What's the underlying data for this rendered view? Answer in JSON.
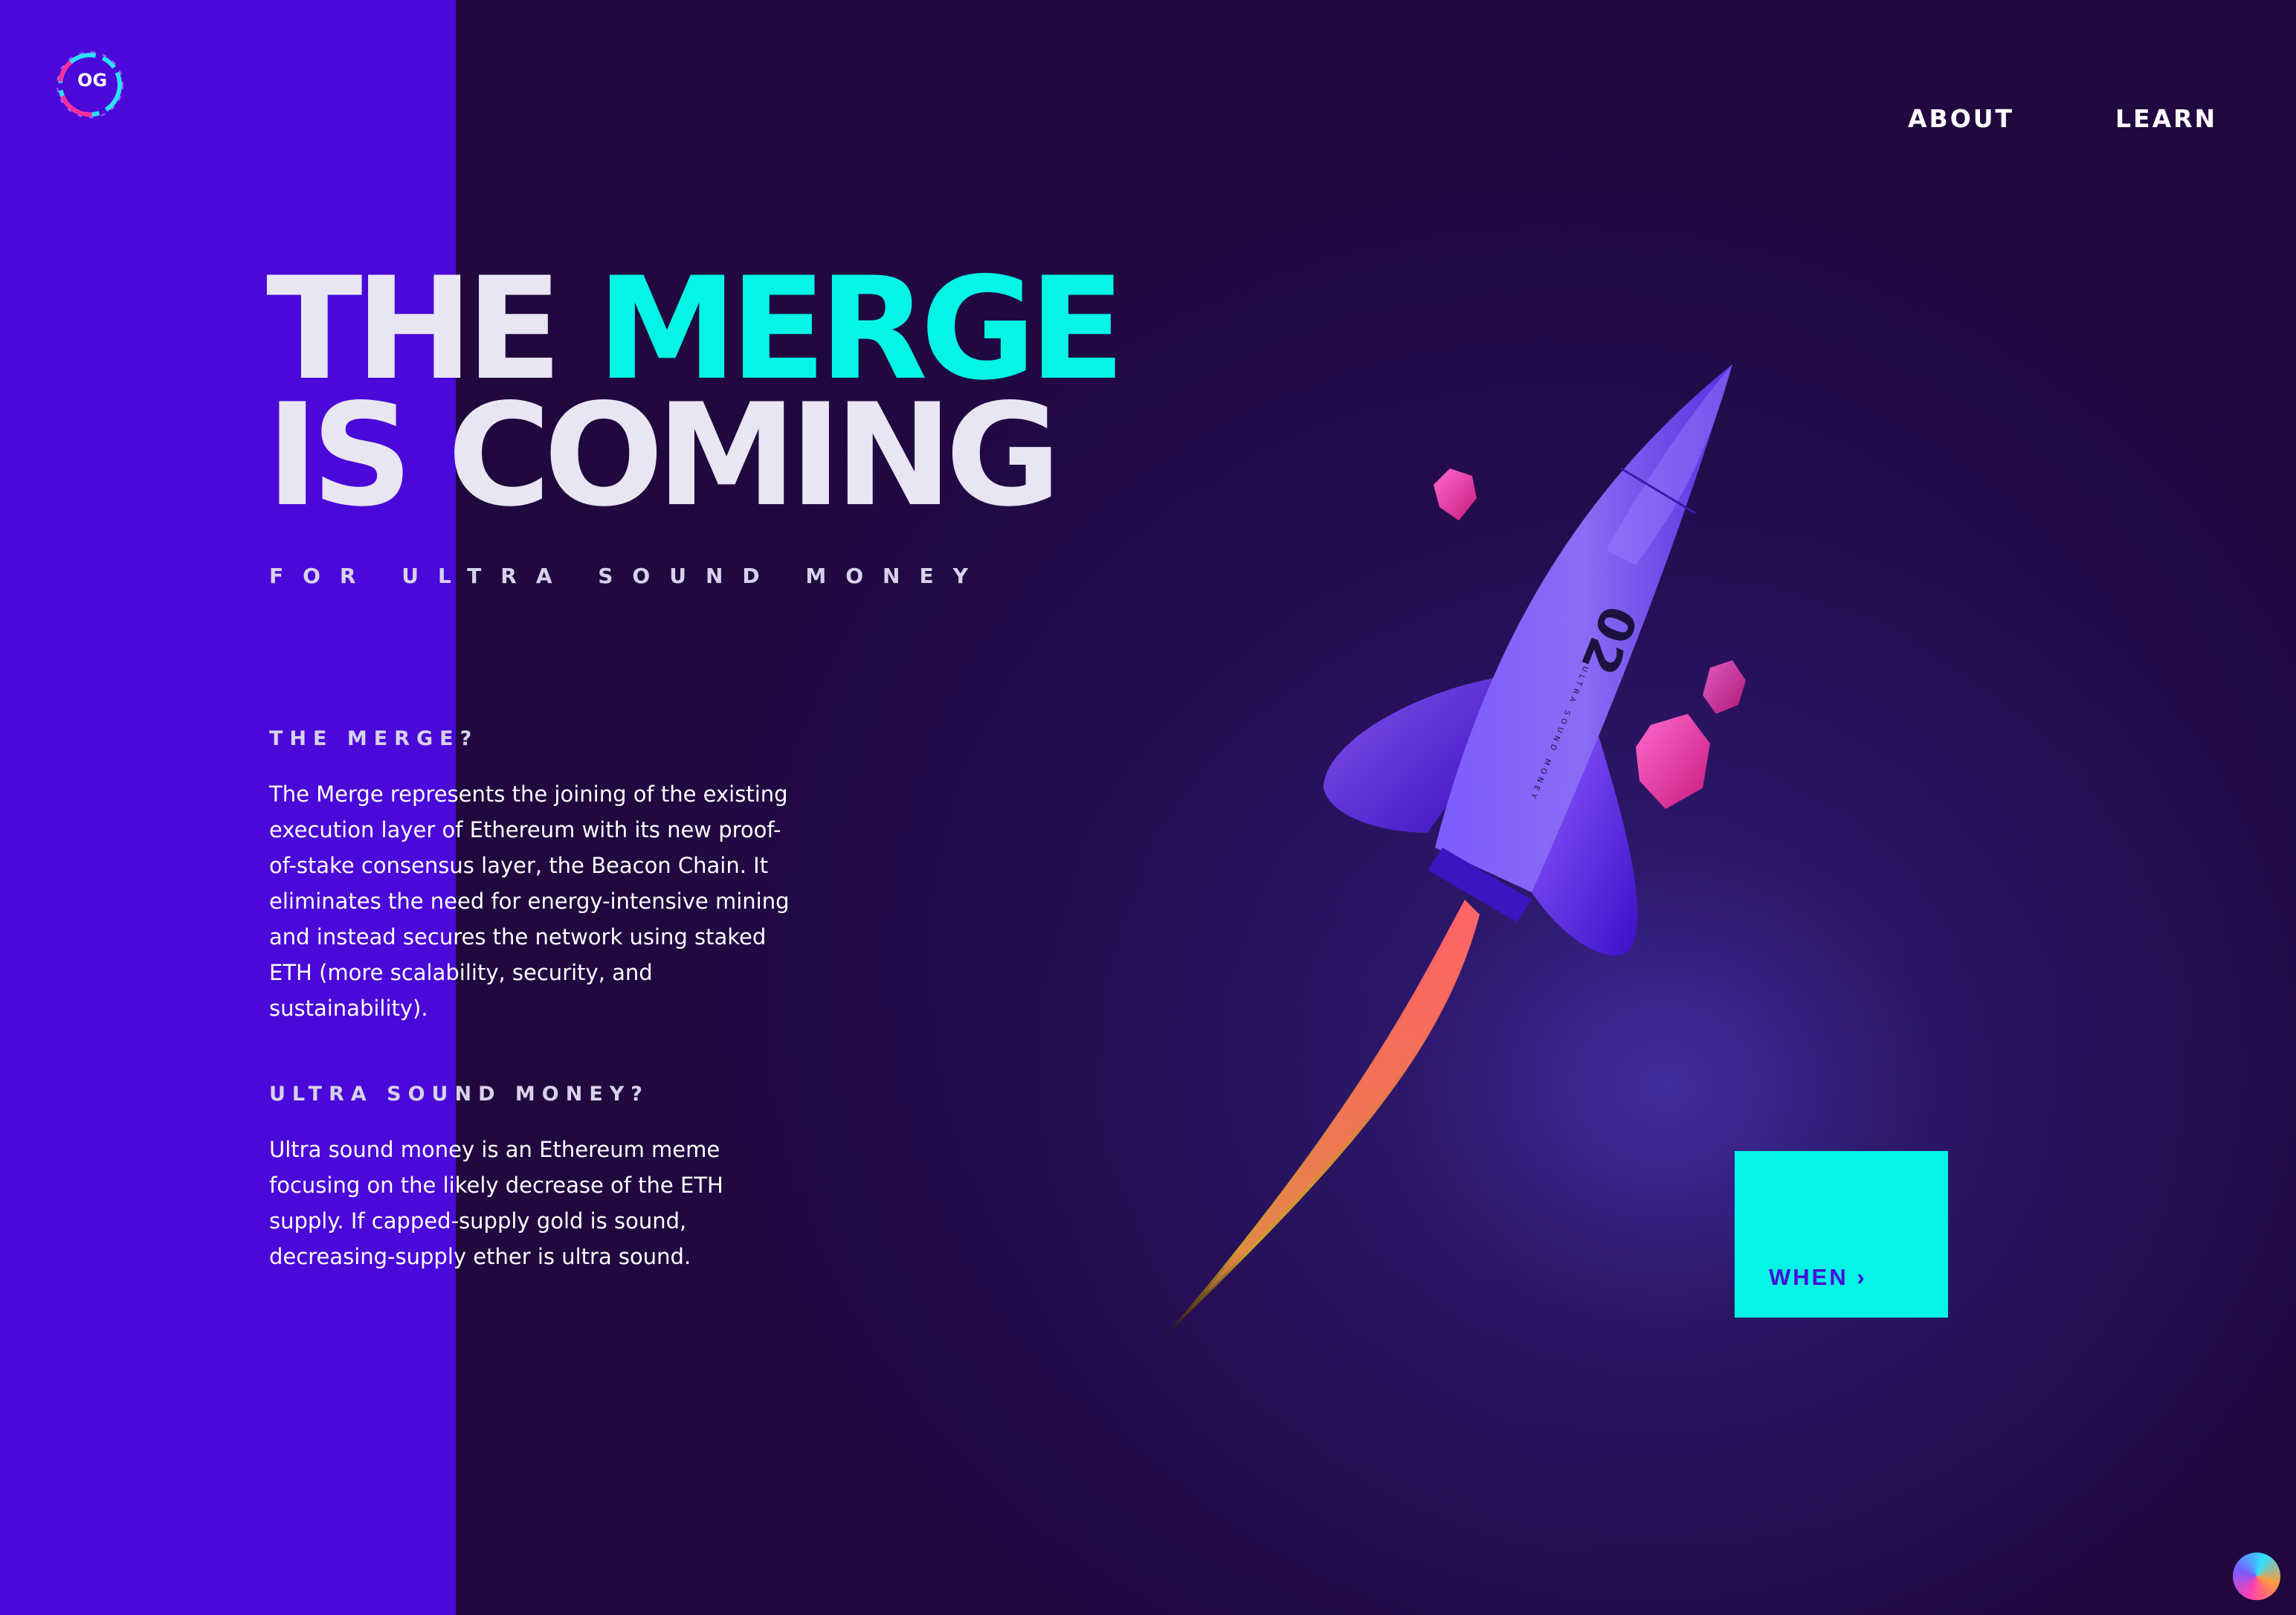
{
  "brand": {
    "logo_text": "OG"
  },
  "nav": {
    "about": "ABOUT",
    "learn": "LEARN"
  },
  "hero": {
    "line1_plain": "THE",
    "line1_accent": "MERGE",
    "line2": "IS COMING",
    "subtitle": "FOR ULTRA SOUND MONEY"
  },
  "sections": [
    {
      "title": "THE MERGE?",
      "body": "The Merge represents the joining of the existing execution layer of Ethereum with its new proof-of-stake consensus layer, the Beacon Chain. It eliminates the need for energy-intensive mining and instead secures the network using staked ETH (more scalability, security, and sustainability)."
    },
    {
      "title": "ULTRA SOUND MONEY?",
      "body": "Ultra sound money is an Ethereum meme focusing on the likely decrease of the ETH supply. If capped-supply gold is sound, decreasing-supply ether is ultra sound."
    }
  ],
  "rocket": {
    "number": "02",
    "side_text": "ULTRA SOUND MONEY"
  },
  "cta": {
    "label": "WHEN ›"
  },
  "colors": {
    "background": "#21083f",
    "left_panel": "#4a09d8",
    "accent": "#03f5e6",
    "gems": "#ff3fb0"
  },
  "icons": {
    "logo": "og-logo-icon",
    "corner": "color-orb-icon"
  }
}
